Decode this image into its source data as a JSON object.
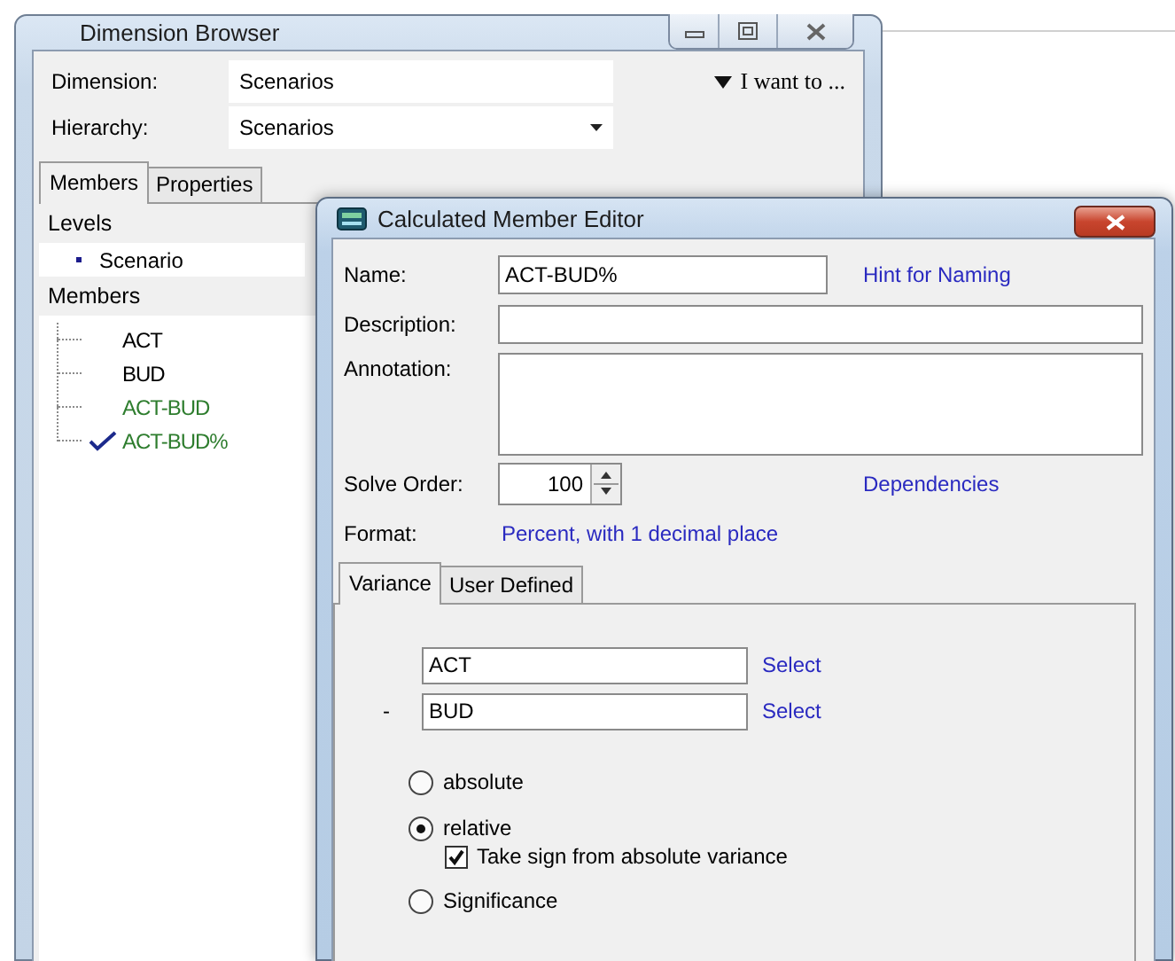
{
  "dimension_browser": {
    "title": "Dimension Browser",
    "fields": [
      {
        "label": "Dimension:",
        "value": "Scenarios",
        "kind": "text"
      },
      {
        "label": "Hierarchy:",
        "value": "Scenarios",
        "kind": "dropdown"
      }
    ],
    "action_menu": "I want to ...",
    "tabs": [
      {
        "label": "Members",
        "selected": true
      },
      {
        "label": "Properties",
        "selected": false
      }
    ],
    "levels_header": "Levels",
    "levels": [
      "Scenario"
    ],
    "members_header": "Members",
    "members": [
      {
        "label": "ACT",
        "kind": "base",
        "checked": false
      },
      {
        "label": "BUD",
        "kind": "base",
        "checked": false
      },
      {
        "label": "ACT-BUD",
        "kind": "calculated",
        "checked": false
      },
      {
        "label": "ACT-BUD%",
        "kind": "calculated",
        "checked": true
      }
    ]
  },
  "member_editor": {
    "title": "Calculated Member Editor",
    "name": {
      "label": "Name:",
      "value": "ACT-BUD%",
      "link": "Hint for Naming"
    },
    "description": {
      "label": "Description:"
    },
    "annotation": {
      "label": "Annotation:"
    },
    "solve_order": {
      "label": "Solve Order:",
      "value": "100",
      "link": "Dependencies"
    },
    "format": {
      "label": "Format:",
      "value": "Percent, with 1 decimal place"
    },
    "tabs": [
      {
        "label": "Variance",
        "selected": true
      },
      {
        "label": "User Defined",
        "selected": false
      }
    ],
    "operands": [
      {
        "value": "ACT",
        "link": "Select"
      },
      {
        "operator": "-",
        "value": "BUD",
        "link": "Select"
      }
    ],
    "options": [
      {
        "kind": "radio",
        "label": "absolute",
        "selected": false
      },
      {
        "kind": "radio",
        "label": "relative",
        "selected": true
      },
      {
        "kind": "checkbox",
        "label": "Take sign from absolute variance",
        "checked": true
      },
      {
        "kind": "radio",
        "label": "Significance",
        "selected": false
      }
    ]
  }
}
